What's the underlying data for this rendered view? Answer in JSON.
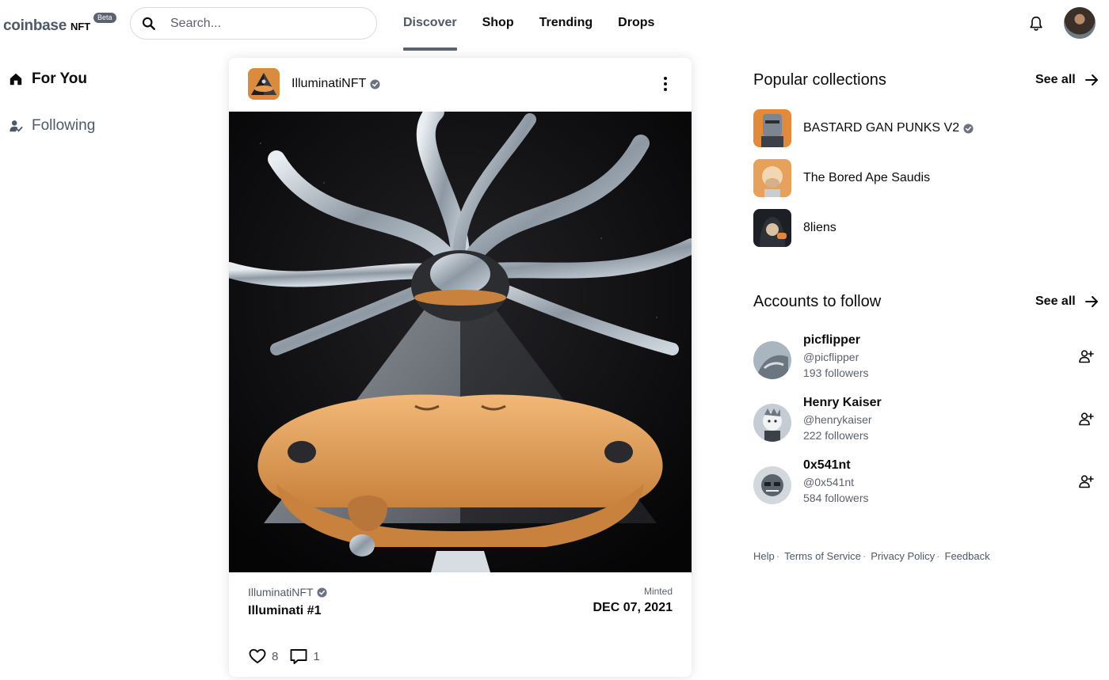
{
  "header": {
    "logo_word": "coinbase",
    "logo_nft": "NFT",
    "beta_badge": "Beta",
    "search_placeholder": "Search...",
    "nav": [
      {
        "label": "Discover",
        "active": true
      },
      {
        "label": "Shop",
        "active": false
      },
      {
        "label": "Trending",
        "active": false
      },
      {
        "label": "Drops",
        "active": false
      }
    ]
  },
  "sidebar": {
    "items": [
      {
        "label": "For You",
        "icon": "home-icon",
        "active": true
      },
      {
        "label": "Following",
        "icon": "user-check-icon",
        "active": false
      }
    ]
  },
  "post": {
    "collection": "IlluminatiNFT",
    "verified": true,
    "title": "Illuminati #1",
    "minted_label": "Minted",
    "minted_date": "DEC 07, 2021",
    "likes": "8",
    "comments": "1"
  },
  "popular": {
    "title": "Popular collections",
    "see_all": "See all",
    "items": [
      {
        "name": "BASTARD GAN PUNKS V2",
        "verified": true
      },
      {
        "name": "The Bored Ape Saudis",
        "verified": false
      },
      {
        "name": "8liens",
        "verified": false
      }
    ]
  },
  "accounts": {
    "title": "Accounts to follow",
    "see_all": "See all",
    "items": [
      {
        "name": "picflipper",
        "handle": "@picflipper",
        "followers": "193 followers"
      },
      {
        "name": "Henry Kaiser",
        "handle": "@henrykaiser",
        "followers": "222 followers"
      },
      {
        "name": "0x541nt",
        "handle": "@0x541nt",
        "followers": "584 followers"
      }
    ]
  },
  "footer": {
    "links": [
      "Help",
      "Terms of Service",
      "Privacy Policy",
      "Feedback"
    ]
  },
  "colors": {
    "text": "#0a0b0d",
    "muted": "#5b616e",
    "border": "#d8dbe0"
  }
}
